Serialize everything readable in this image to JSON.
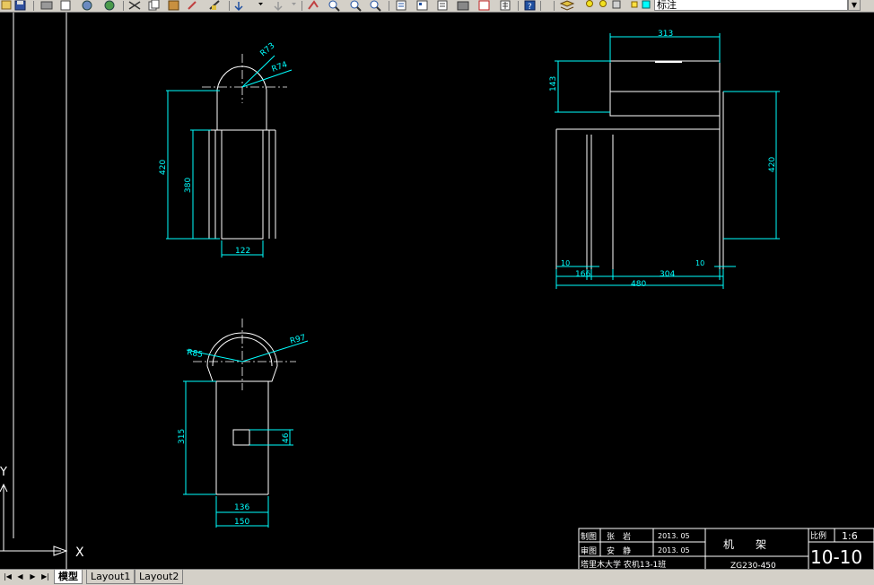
{
  "toolbar": {
    "layer_name": "标注"
  },
  "tabs": [
    {
      "label": "模型",
      "active": true
    },
    {
      "label": "Layout1",
      "active": false
    },
    {
      "label": "Layout2",
      "active": false
    }
  ],
  "ucs": {
    "y_label": "Y",
    "x_label": "X"
  },
  "view1": {
    "dims": {
      "r73": "R73",
      "r74": "R74",
      "h420": "420",
      "h380": "380",
      "w122": "122"
    }
  },
  "view2": {
    "dims": {
      "r85": "R85",
      "r97": "R97",
      "h315": "315",
      "h46": "46",
      "w136": "136",
      "w150": "150"
    }
  },
  "view3": {
    "dims": {
      "w313": "313",
      "h143": "143",
      "h420": "420",
      "d10a": "10",
      "d166": "166",
      "d304": "304",
      "d10b": "10",
      "d480": "480"
    }
  },
  "title_block": {
    "drawn_label": "制图",
    "drawn_name": "张　岩",
    "drawn_date": "2013. 05",
    "checked_label": "审图",
    "checked_name": "安　静",
    "checked_date": "2013. 05",
    "school": "塔里木大学 农机13-1班",
    "part_name": "机　　架",
    "drawing_no": "ZG230-450",
    "scale_label": "比例",
    "scale_value": "1:6",
    "sheet_no": "10-10"
  },
  "colors": {
    "dim": "#00ffff",
    "geom": "#ffffff",
    "background": "#000000"
  }
}
